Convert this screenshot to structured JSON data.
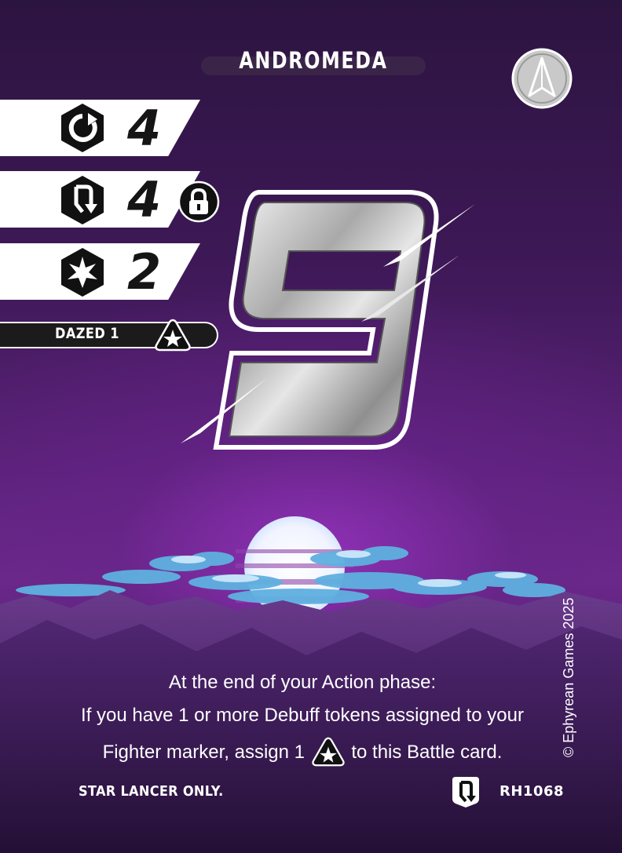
{
  "card": {
    "title": "ANDROMEDA",
    "faction_icon": "arrowhead-emblem-icon",
    "big_number": "9",
    "stats": [
      {
        "icon": "refresh-hex-icon",
        "value": "4"
      },
      {
        "icon": "lancer-hex-icon",
        "value": "4",
        "badge_icon": "padlock-icon"
      },
      {
        "icon": "burst-hex-icon",
        "value": "2"
      }
    ],
    "dazed": {
      "label": "DAZED 1",
      "icon": "star-triangle-icon"
    },
    "ability": {
      "line1": "At the end of your Action phase:",
      "line2": "If you have 1 or more Debuff tokens assigned to your",
      "line3_before": "Fighter marker, assign 1",
      "line3_icon": "star-triangle-icon",
      "line3_after": "to this Battle card."
    },
    "restriction": "STAR LANCER ONLY.",
    "class_icon": "lancer-shield-icon",
    "code": "RH1068",
    "copyright": "© Ephyrean Games 2025"
  },
  "colors": {
    "background_top": "#2c1440",
    "background_glow": "#96 32be",
    "stat_band": "#ffffff",
    "hex_icon": "#111111",
    "big_number_silver": "#c8c8c8",
    "clouds": "#5fb0e0",
    "moon": "#ffffff"
  }
}
